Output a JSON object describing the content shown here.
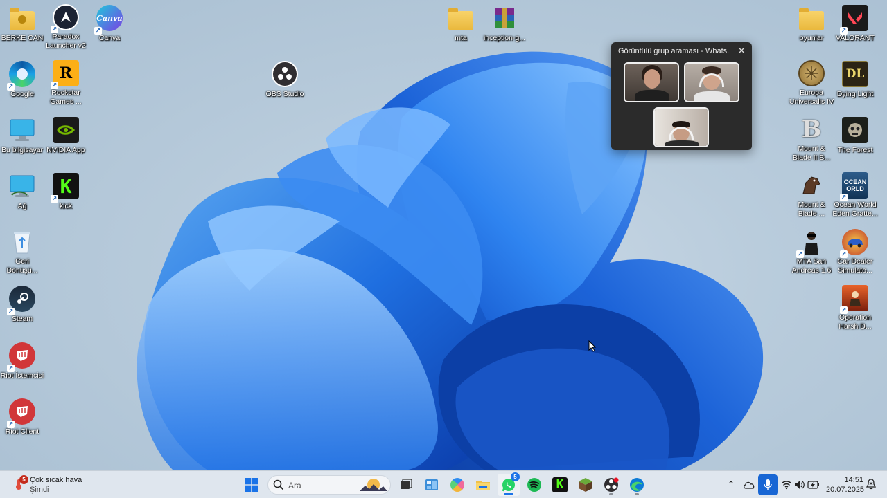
{
  "desktop": {
    "icons": {
      "berke_can": "BERKE CAN",
      "paradox": "Paradox\nLauncher v2",
      "canva": "Canva",
      "canva_logo": "Canva",
      "google": "Google",
      "rockstar": "Rockstar\nGames ...",
      "rockstar_logo": "R",
      "obs": "OBS Studio",
      "bu_bilgisayar": "Bu bilgisayar",
      "nvidia": "NVIDIA App",
      "ag": "Ağ",
      "kick": "kick",
      "kick_logo": "K",
      "geri_donusum": "Geri\nDönüşü...",
      "steam": "Steam",
      "riot_istemcisi": "Riot İstemcisi",
      "riot_client": "Riot Client",
      "mta": "mta",
      "inception": "inception-g...",
      "oyunlar": "oyunlar",
      "valorant": "VALORANT",
      "europa": "Europa\nUniversalis IV",
      "dying_light": "Dying Light",
      "dying_light_logo": "DL",
      "mount_blade_2": "Mount &\nBlade II B...",
      "mount_blade_2_logo": "B",
      "the_forest": "The Forest",
      "mount_blade": "Mount &\nBlade ...",
      "ocean_world": "Ocean World\nEden Gratte...",
      "ocean_world_logo": "OCEAN\nORLD",
      "mta_sa": "MTA San\nAndreas 1.6",
      "car_dealer": "Car Dealer\nSimulato...",
      "operation_harsh": "Operation\nHarsh D..."
    }
  },
  "call_window": {
    "title": "Görüntülü grup araması - Whats...",
    "close_glyph": "✕"
  },
  "taskbar": {
    "weather": {
      "badge": "5",
      "condition": "Çok sıcak hava",
      "time_label": "Şimdi"
    },
    "search": {
      "placeholder": "Ara"
    },
    "whatsapp_badge": "5",
    "tray_arrow": "⌃",
    "clock": {
      "time": "14:51",
      "date": "20.07.2025"
    }
  },
  "colors": {
    "taskbar_bg": "#dfe6ee",
    "accent_blue": "#1866d4",
    "whatsapp_green": "#25d366",
    "spotify_green": "#1db954",
    "kick_green": "#53fc18",
    "riot_red": "#d13639",
    "valorant_red": "#ff4655"
  }
}
